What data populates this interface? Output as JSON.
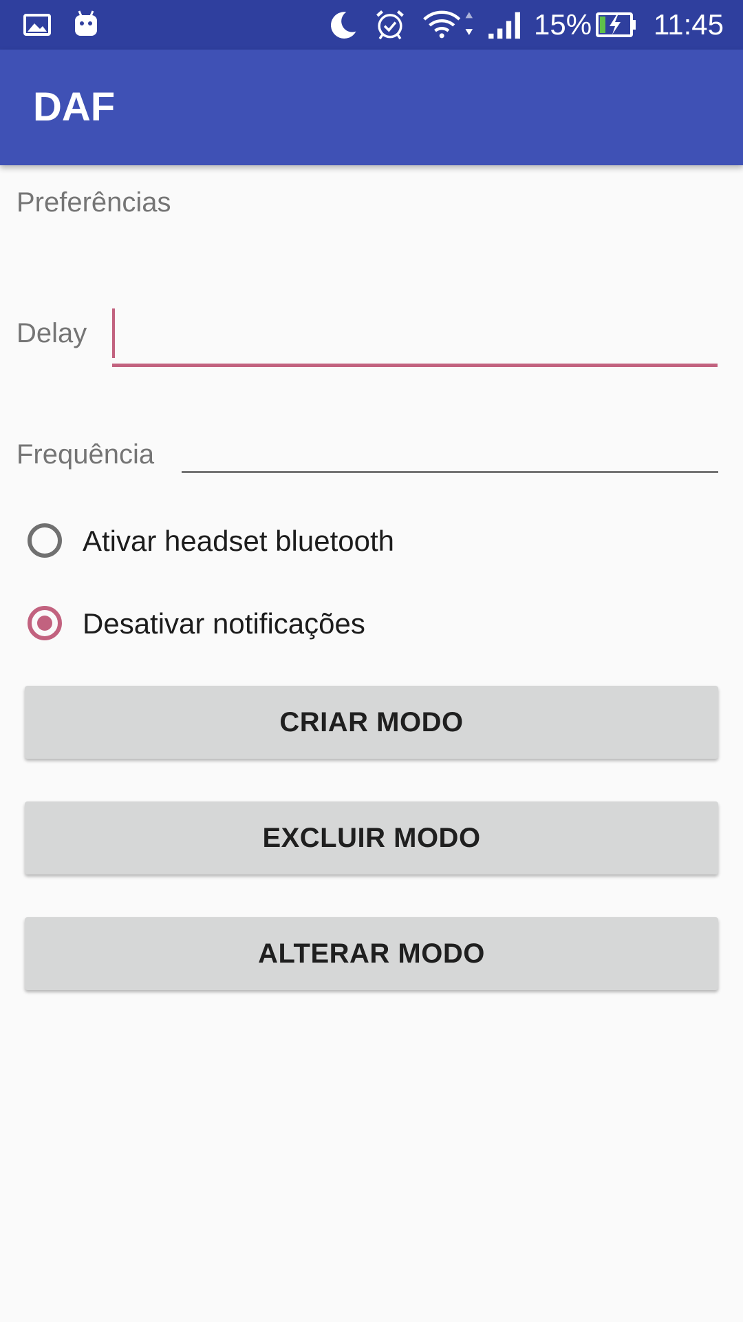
{
  "status_bar": {
    "icons": [
      "image-icon",
      "android-icon",
      "moon-icon",
      "alarm-icon",
      "wifi-icon",
      "signal-icon",
      "battery-charging-icon"
    ],
    "battery_percent": "15%",
    "time": "11:45"
  },
  "app_bar": {
    "title": "DAF"
  },
  "form": {
    "section_title": "Preferências",
    "delay_label": "Delay",
    "delay_value": "",
    "frequency_label": "Frequência",
    "frequency_value": ""
  },
  "options": [
    {
      "label": "Ativar headset bluetooth",
      "checked": false
    },
    {
      "label": "Desativar notificações",
      "checked": true
    }
  ],
  "buttons": {
    "create": "CRIAR MODO",
    "delete": "EXCLUIR MODO",
    "edit": "ALTERAR MODO"
  },
  "colors": {
    "status_bar": "#2f3f9e",
    "app_bar": "#3f51b5",
    "accent": "#c2627f",
    "background": "#fafafa",
    "button": "#d6d7d7"
  }
}
